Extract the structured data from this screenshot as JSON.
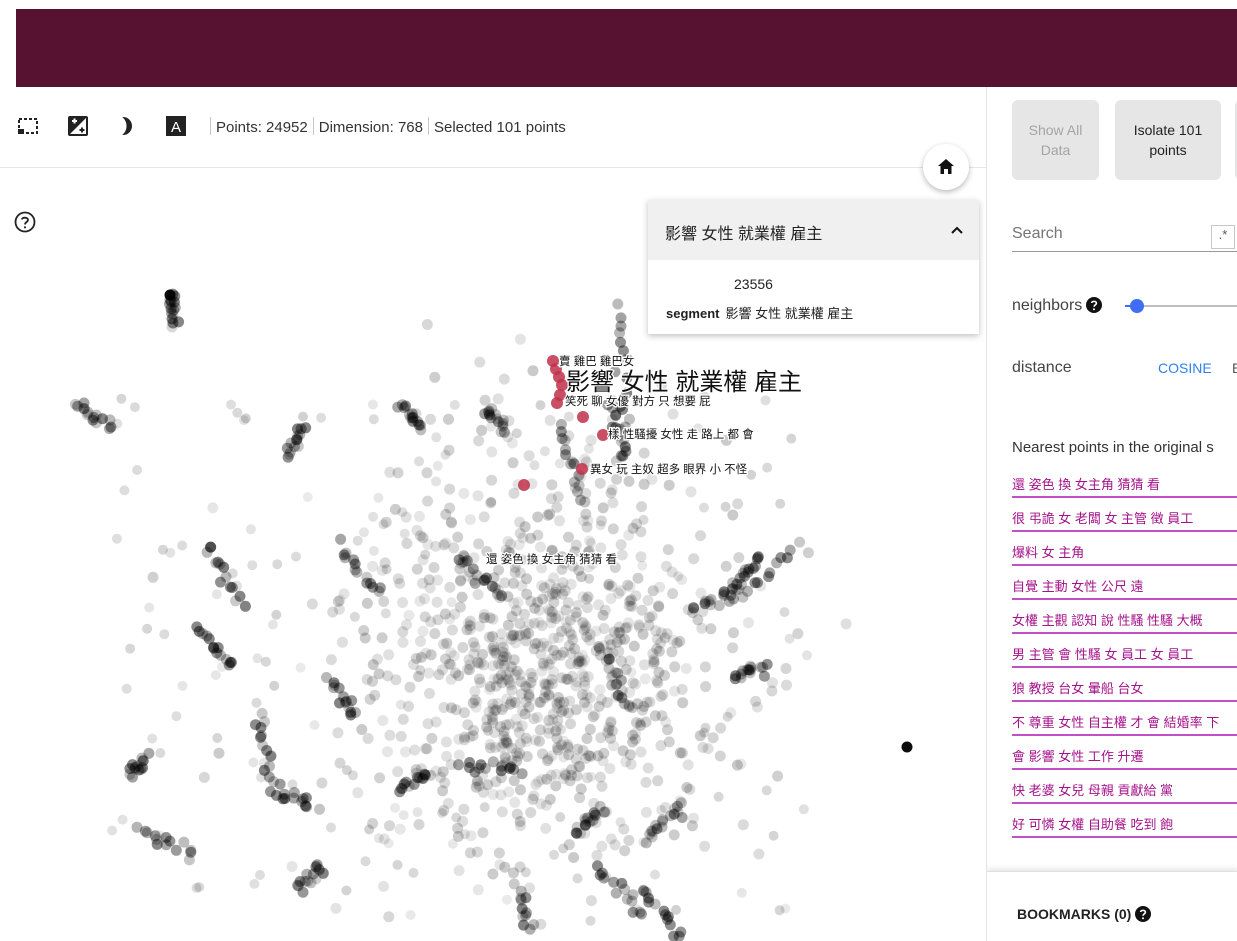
{
  "toolbar": {
    "stats": {
      "points": "Points: 24952",
      "dimension": "Dimension: 768",
      "selected": "Selected 101 points"
    },
    "icons": [
      "selection-icon",
      "night-mode-icon",
      "moon-icon",
      "label-toggle-icon"
    ]
  },
  "info_card": {
    "title": "影響 女性 就業權 雇主",
    "id": "23556",
    "segment_label": "segment",
    "segment_value": "影響 女性 就業權 雇主"
  },
  "plot_labels": {
    "highlight": "影響 女性 就業權 雇主",
    "label1": "賣 雞巴 雞巴女",
    "label2": "笑死 聊 女優 對方 只 想要 屁",
    "label3": "樣 性騷擾 女性 走 路上 都 會",
    "label4": "異女 玩 主奴 超多 眼界 小 不怪",
    "label5": "還 姿色 換 女主角 猜猜 看"
  },
  "panel": {
    "show_all": [
      "Show All",
      "Data"
    ],
    "isolate": [
      "Isolate 101",
      "points"
    ],
    "search_placeholder": "Search",
    "regex_label": ".*",
    "neighbors_label": "neighbors",
    "neighbors_fraction": 0.1,
    "distance_label": "distance",
    "cosine_label": "COSINE",
    "euclidean_label": "E",
    "nearest_heading": "Nearest points in the original s",
    "nearest": [
      "還 姿色 換 女主角 猜猜 看",
      "很 弔詭 女 老闆 女 主管 徵 員工",
      "爆料 女 主角",
      "自覺 主動 女性 公尺 遠",
      "女權 主觀 認知 說 性騷 性騷 大概",
      "男 主管 會 性騷 女 員工 女 員工",
      "狼 教授 台女 暈船 台女",
      "不 尊重 女性 自主權 才 會 結婚率 下",
      "會 影響 女性 工作 升遷",
      "快 老婆 女兒 母親 貢獻給 黨",
      "好 可憐 女權 自助餐 吃到 飽"
    ],
    "bookmarks_label": "BOOKMARKS (0)"
  },
  "colors": {
    "topbar": "#561230",
    "point": "#000000",
    "selected_point": "#c0304a",
    "nearest_text": "#a4138a",
    "accent_blue": "#3f6df5"
  }
}
